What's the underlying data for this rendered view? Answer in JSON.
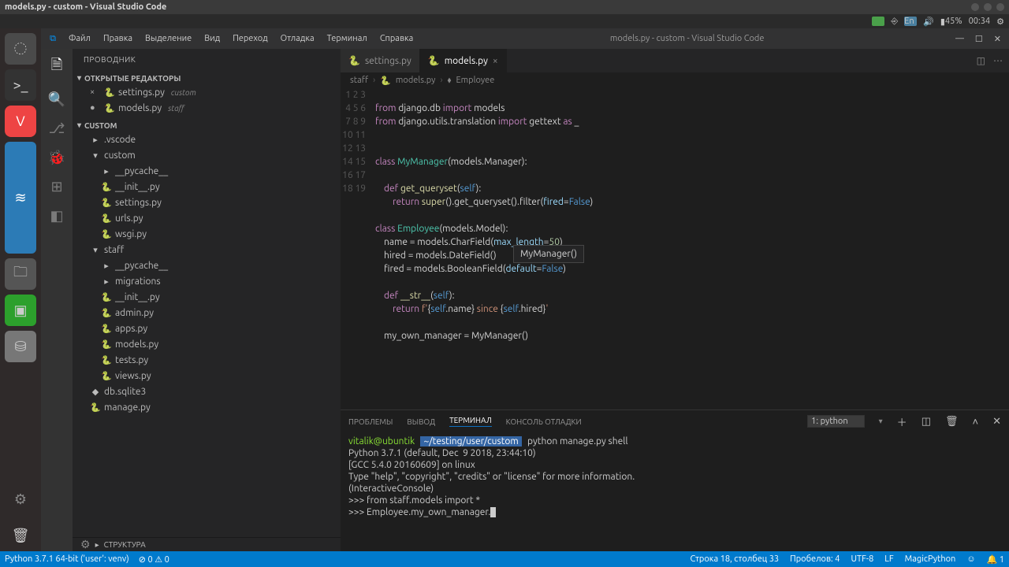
{
  "ubuntu": {
    "title": "models.py - custom - Visual Studio Code",
    "panel": {
      "lang": "En",
      "time": "00:34",
      "battery": "45%"
    }
  },
  "vscode": {
    "menu": [
      "Файл",
      "Правка",
      "Выделение",
      "Вид",
      "Переход",
      "Отладка",
      "Терминал",
      "Справка"
    ],
    "wintitle": "models.py - custom - Visual Studio Code",
    "sidebar": {
      "title": "Проводник",
      "open_editors_label": "Открытые редакторы",
      "open_editors": [
        {
          "name": "settings.py",
          "dim": "custom",
          "modified": false
        },
        {
          "name": "models.py",
          "dim": "staff",
          "modified": true
        }
      ],
      "workspace_label": "CUSTOM",
      "tree": [
        {
          "name": ".vscode",
          "type": "folder",
          "indent": 1,
          "open": false
        },
        {
          "name": "custom",
          "type": "folder",
          "indent": 1,
          "open": true
        },
        {
          "name": "__pycache__",
          "type": "folder",
          "indent": 2,
          "open": false
        },
        {
          "name": "__init__.py",
          "type": "file",
          "indent": 2
        },
        {
          "name": "settings.py",
          "type": "file",
          "indent": 2
        },
        {
          "name": "urls.py",
          "type": "file",
          "indent": 2
        },
        {
          "name": "wsgi.py",
          "type": "file",
          "indent": 2
        },
        {
          "name": "staff",
          "type": "folder",
          "indent": 1,
          "open": true
        },
        {
          "name": "__pycache__",
          "type": "folder",
          "indent": 2,
          "open": false
        },
        {
          "name": "migrations",
          "type": "folder",
          "indent": 2,
          "open": false
        },
        {
          "name": "__init__.py",
          "type": "file",
          "indent": 2
        },
        {
          "name": "admin.py",
          "type": "file",
          "indent": 2
        },
        {
          "name": "apps.py",
          "type": "file",
          "indent": 2
        },
        {
          "name": "models.py",
          "type": "file",
          "indent": 2
        },
        {
          "name": "tests.py",
          "type": "file",
          "indent": 2
        },
        {
          "name": "views.py",
          "type": "file",
          "indent": 2
        },
        {
          "name": "db.sqlite3",
          "type": "file",
          "indent": 1
        },
        {
          "name": "manage.py",
          "type": "file",
          "indent": 1
        }
      ],
      "structure_label": "Структура"
    },
    "tabs": [
      {
        "label": "settings.py",
        "active": false
      },
      {
        "label": "models.py",
        "active": true,
        "modified": true
      }
    ],
    "breadcrumb": [
      "staff",
      "models.py",
      "Employee"
    ],
    "line_count": 19,
    "hint": "MyManager()",
    "panel": {
      "tabs": [
        "Проблемы",
        "Вывод",
        "Терминал",
        "Консоль отладки"
      ],
      "active_tab": 2,
      "term_selector": "1: python",
      "terminal": {
        "user": "vitalik@ubuntik",
        "path": "~/testing/user/custom",
        "cmd": "python manage.py shell",
        "l1": "Python 3.7.1 (default, Dec  9 2018, 23:44:10)",
        "l2": "[GCC 5.4.0 20160609] on linux",
        "l3": "Type \"help\", \"copyright\", \"credits\" or \"license\" for more information.",
        "l4": "(InteractiveConsole)",
        "l5": ">>> from staff.models import *",
        "l6": ">>> Employee.my_own_manager."
      }
    },
    "status": {
      "python": "Python 3.7.1 64-bit ('user': venv)",
      "errors": "0",
      "warnings": "0",
      "cursor": "Строка 18, столбец 33",
      "spaces": "Пробелов: 4",
      "encoding": "UTF-8",
      "eol": "LF",
      "lang": "MagicPython",
      "notif": "1"
    }
  }
}
